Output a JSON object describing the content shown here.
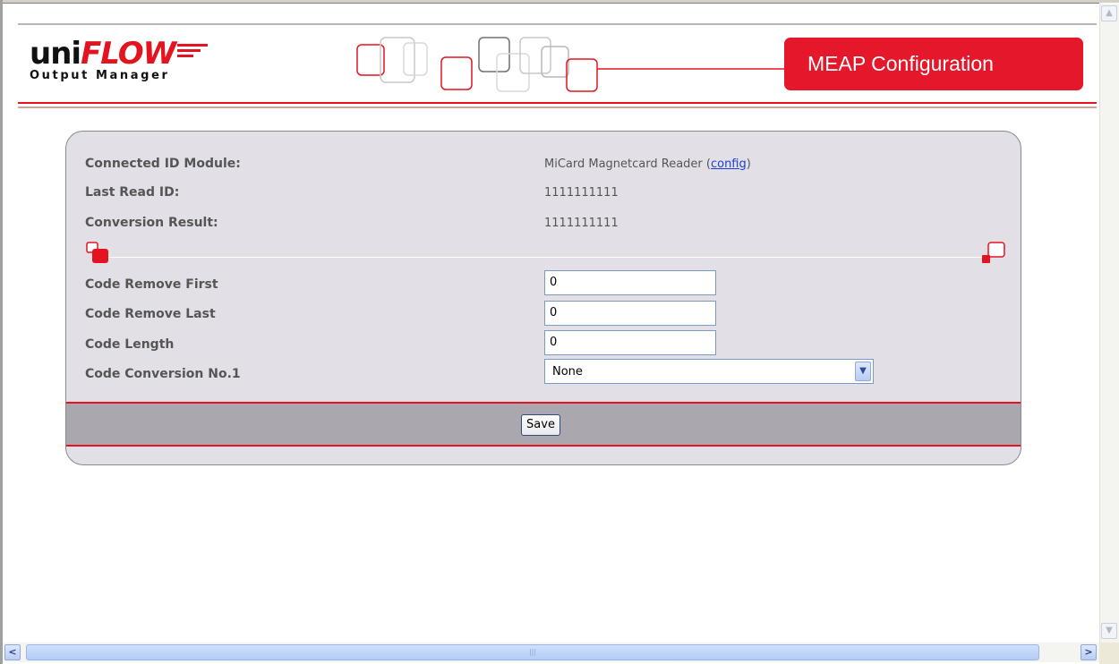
{
  "header": {
    "logo_main_prefix": "uni",
    "logo_main_brand": "FLOW",
    "logo_subtitle": "Output Manager",
    "badge_title": "MEAP Configuration"
  },
  "info": {
    "connected_module_label": "Connected ID Module:",
    "connected_module_value": "MiCard Magnetcard Reader (",
    "connected_module_link": "config",
    "connected_module_suffix": ")",
    "last_read_label": "Last Read ID:",
    "last_read_value": "1111111111",
    "conversion_label": "Conversion Result:",
    "conversion_value": "1111111111"
  },
  "form": {
    "code_remove_first_label": "Code Remove First",
    "code_remove_first_value": "0",
    "code_remove_last_label": "Code Remove Last",
    "code_remove_last_value": "0",
    "code_length_label": "Code Length",
    "code_length_value": "0",
    "code_conversion_label": "Code Conversion No.1",
    "code_conversion_value": "None",
    "save_label": "Save"
  },
  "colors": {
    "brand_red": "#e3141f",
    "panel_bg": "#e2e0e6",
    "save_bar_bg": "#aaa8ae"
  },
  "icons": {
    "select_arrow": "chevron-down-icon",
    "scroll_left": "arrow-left-icon",
    "scroll_right": "arrow-right-icon",
    "scroll_up": "arrow-up-icon",
    "scroll_down": "arrow-down-icon"
  }
}
